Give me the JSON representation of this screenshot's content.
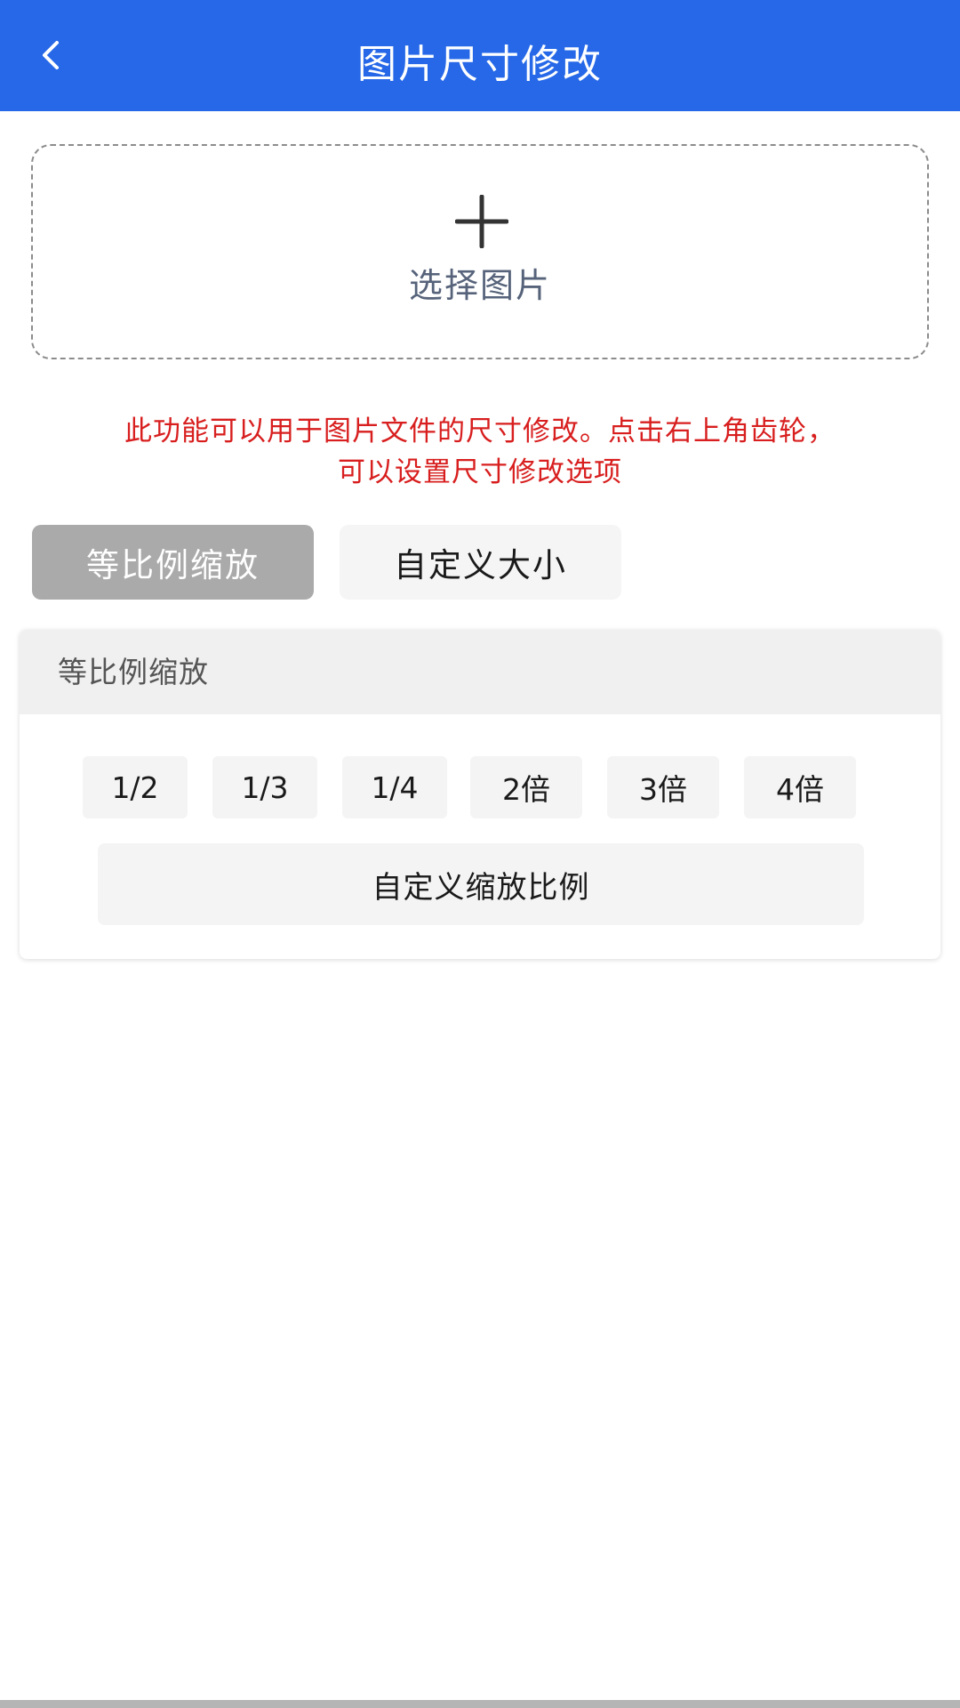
{
  "header": {
    "title": "图片尺寸修改",
    "background": "#2668e8"
  },
  "upload": {
    "label": "选择图片"
  },
  "info": {
    "line1": "此功能可以用于图片文件的尺寸修改。点击右上角齿轮，",
    "line2": "可以设置尺寸修改选项",
    "color": "#d81e1e"
  },
  "modes": [
    {
      "label": "等比例缩放",
      "selected": true
    },
    {
      "label": "自定义大小",
      "selected": false
    }
  ],
  "panel": {
    "title": "等比例缩放",
    "scale_options": [
      "1/2",
      "1/3",
      "1/4",
      "2倍",
      "3倍",
      "4倍"
    ],
    "custom_label": "自定义缩放比例"
  }
}
